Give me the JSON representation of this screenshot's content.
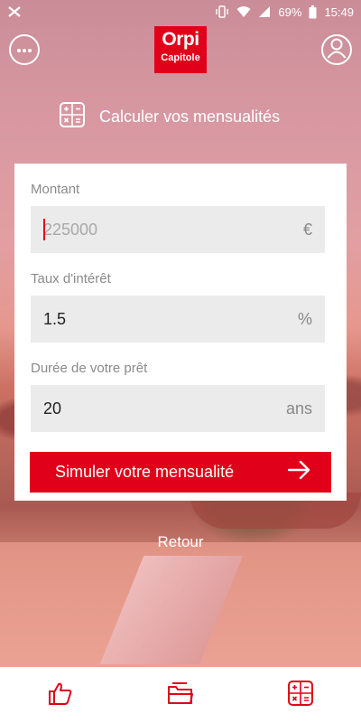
{
  "status_bar": {
    "battery": "69%",
    "time": "15:49"
  },
  "header": {
    "logo_brand": "Orpi",
    "logo_sub": "Capitole",
    "menu_icon": "more-dots-icon",
    "profile_icon": "user-icon"
  },
  "calculator": {
    "title": "Calculer vos mensualités",
    "icon": "calculator-icon"
  },
  "form": {
    "amount": {
      "label": "Montant",
      "placeholder": "225000",
      "value": "",
      "unit": "€"
    },
    "rate": {
      "label": "Taux d'intérêt",
      "value": "1.5",
      "unit": "%"
    },
    "duration": {
      "label": "Durée de votre prêt",
      "value": "20",
      "unit": "ans"
    },
    "submit_label": "Simuler votre mensualité"
  },
  "back_label": "Retour",
  "bottom_nav": {
    "items": [
      "thumbs-up-icon",
      "folder-icon",
      "calculator-icon"
    ]
  },
  "colors": {
    "brand_red": "#e1001a"
  }
}
